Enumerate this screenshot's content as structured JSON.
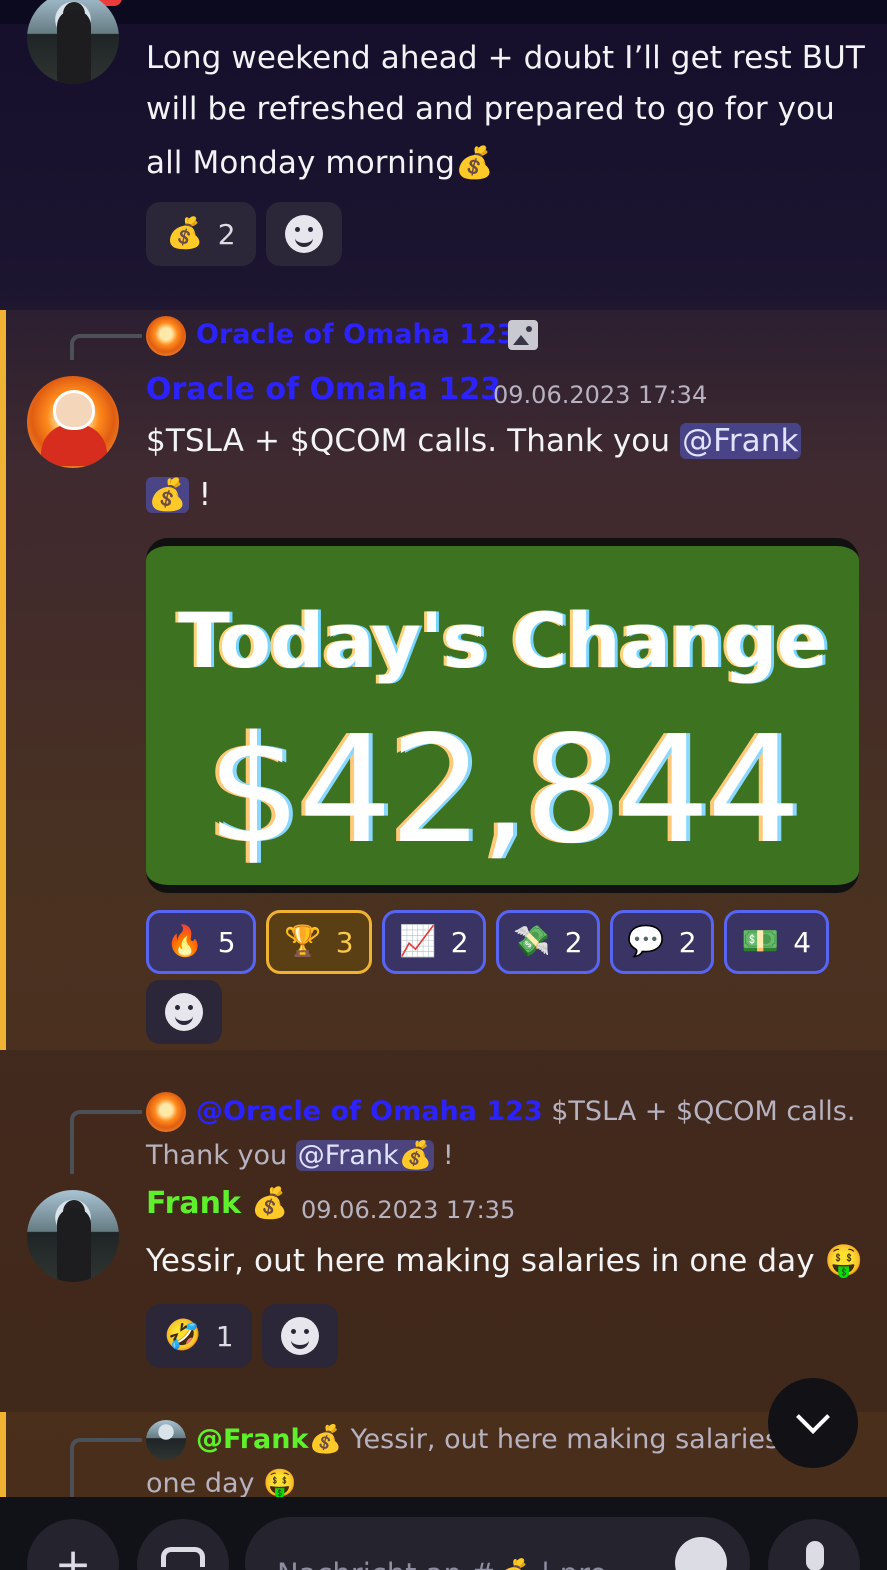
{
  "messages": {
    "first": {
      "text_line1": "Long weekend ahead + doubt I’ll get rest BUT",
      "text_line2": "will be refreshed and prepared to go for you",
      "text_line3": "all Monday morning",
      "text_emoji": "💰",
      "reactions": [
        {
          "emoji": "💰",
          "count": "2"
        }
      ]
    },
    "oracle": {
      "reply_name": "Oracle of Omaha 123",
      "username": "Oracle of Omaha 123",
      "username_color": "#2b22ff",
      "timestamp": "09.06.2023 17:34",
      "text_before": "$TSLA + $QCOM calls.  Thank you ",
      "mention": "@Frank",
      "mention_emoji": "💰",
      "text_after": " !",
      "image_title": "Today's Change",
      "image_amount": "$42,844",
      "reactions": [
        {
          "emoji": "🔥",
          "count": "5"
        },
        {
          "emoji": "🏆",
          "count": "3"
        },
        {
          "emoji": "📈",
          "count": "2"
        },
        {
          "emoji": "💸",
          "count": "2"
        },
        {
          "emoji": "💬",
          "count": "2"
        },
        {
          "emoji": "💵",
          "count": "4"
        }
      ]
    },
    "frank": {
      "reply_name": "@Oracle of Omaha 123",
      "reply_text_1": " $TSLA + $QCOM calls.",
      "reply_text_2": "Thank you ",
      "reply_mention": "@Frank💰",
      "reply_text_3": " !",
      "username": "Frank",
      "username_emoji": "💰",
      "username_color": "#5ef12b",
      "timestamp": "09.06.2023 17:35",
      "text": "Yessir, out here making salaries in one day",
      "text_emoji": "🤑",
      "reactions": [
        {
          "emoji": "🤣",
          "count": "1"
        }
      ]
    },
    "next_reply": {
      "reply_name": "@Frank",
      "reply_name_emoji": "💰",
      "reply_text_1": " Yessir, out here making salaries",
      "reply_text_2": "one day ",
      "reply_text_emoji": "🤑"
    }
  },
  "composer": {
    "plus_label": "+",
    "placeholder": "Nachricht an #💰 | pro"
  },
  "colors": {
    "accent": "#5865f2",
    "highlight": "#f0b232"
  },
  "icons": {
    "add": "plus-icon",
    "gift": "gift-icon",
    "emoji": "emoji-icon",
    "mic": "microphone-icon",
    "scroll": "chevron-down-icon",
    "image": "image-icon"
  }
}
